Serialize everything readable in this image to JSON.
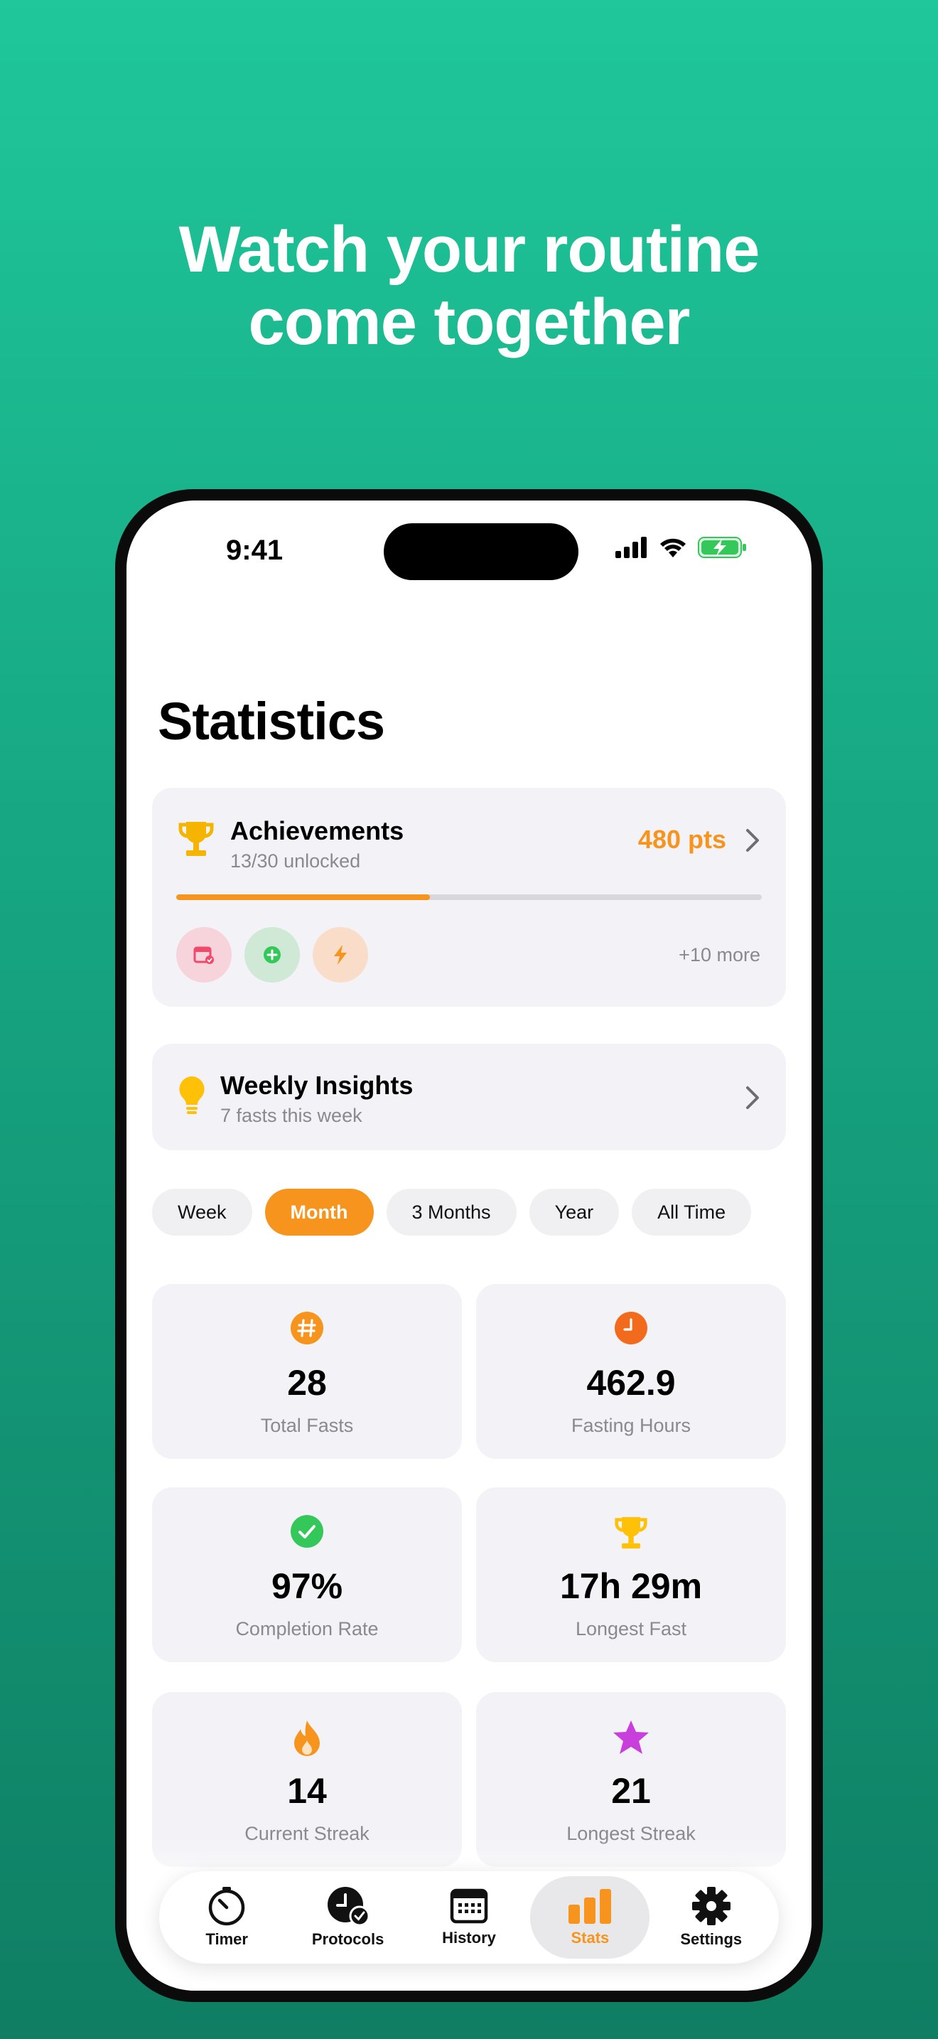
{
  "headline": {
    "line1": "Watch your routine",
    "line2": "come together"
  },
  "status_bar": {
    "time": "9:41"
  },
  "page_title": "Statistics",
  "achievements": {
    "title": "Achievements",
    "subtitle": "13/30 unlocked",
    "points": "480 pts",
    "progress_fraction": 0.433,
    "badges": [
      {
        "icon": "calendar-check-icon",
        "bg": "#f7d3dc",
        "color": "#ef4a6b"
      },
      {
        "icon": "plus-circle-icon",
        "bg": "#cfe9d6",
        "color": "#34c759"
      },
      {
        "icon": "bolt-icon",
        "bg": "#f9ddc9",
        "color": "#f7941d"
      }
    ],
    "more_label": "+10 more"
  },
  "insights": {
    "title": "Weekly Insights",
    "subtitle": "7 fasts this week"
  },
  "ranges": [
    {
      "label": "Week",
      "active": false
    },
    {
      "label": "Month",
      "active": true
    },
    {
      "label": "3 Months",
      "active": false
    },
    {
      "label": "Year",
      "active": false
    },
    {
      "label": "All Time",
      "active": false
    }
  ],
  "stats": [
    {
      "value": "28",
      "label": "Total Fasts",
      "icon": "hash-icon",
      "color": "#f7941d"
    },
    {
      "value": "462.9",
      "label": "Fasting Hours",
      "icon": "clock-icon",
      "color": "#f26b1d"
    },
    {
      "value": "97%",
      "label": "Completion Rate",
      "icon": "checkmark-circle-icon",
      "color": "#34c759"
    },
    {
      "value": "17h 29m",
      "label": "Longest Fast",
      "icon": "trophy-icon",
      "color": "#ffc107"
    },
    {
      "value": "14",
      "label": "Current Streak",
      "icon": "flame-icon",
      "color": "#f7941d"
    },
    {
      "value": "21",
      "label": "Longest Streak",
      "icon": "star-icon",
      "color": "#c83fdc"
    }
  ],
  "tabs": [
    {
      "label": "Timer",
      "icon": "timer-icon",
      "active": false
    },
    {
      "label": "Protocols",
      "icon": "protocols-icon",
      "active": false
    },
    {
      "label": "History",
      "icon": "calendar-icon",
      "active": false
    },
    {
      "label": "Stats",
      "icon": "bar-chart-icon",
      "active": true
    },
    {
      "label": "Settings",
      "icon": "gear-icon",
      "active": false
    }
  ],
  "colors": {
    "accent": "#f7941d",
    "card_bg": "#f2f2f7",
    "background_top": "#1fc79a",
    "background_bottom": "#0f7e63"
  }
}
